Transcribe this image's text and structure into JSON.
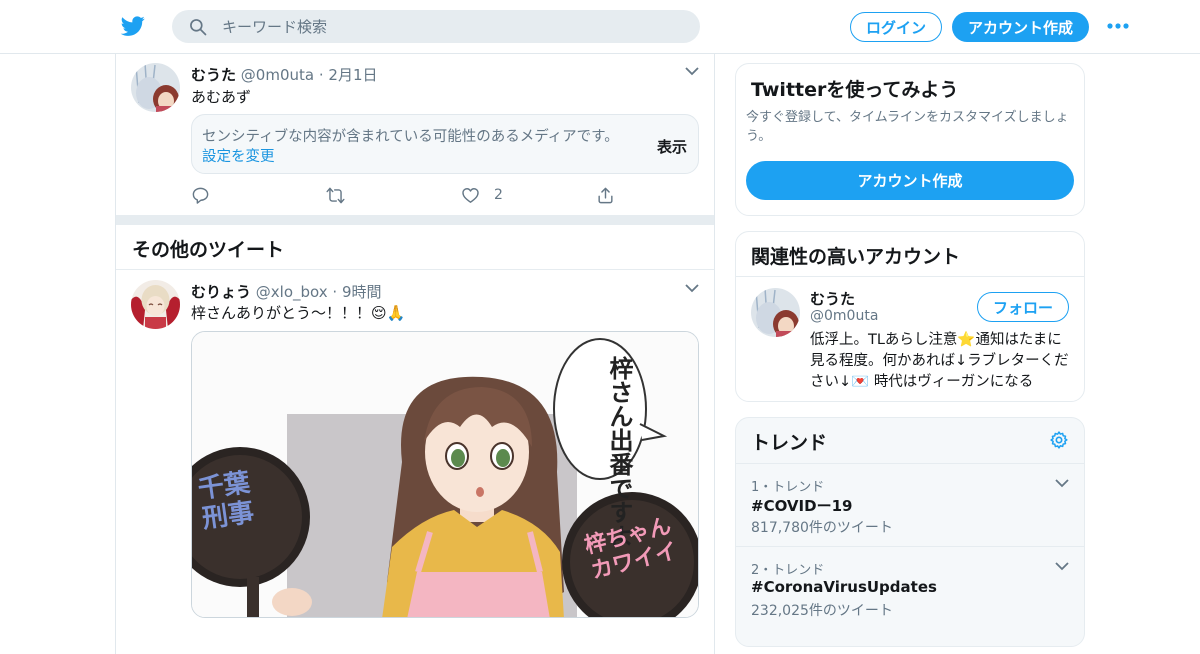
{
  "header": {
    "search_placeholder": "キーワード検索",
    "login_label": "ログイン",
    "signup_label": "アカウント作成"
  },
  "tweet1": {
    "name": "むうた",
    "handle": "@0m0uta",
    "date": "2月1日",
    "text": "あむあず",
    "sensitive_message": "センシティブな内容が含まれている可能性のあるメディアです。",
    "change_settings": "設定を変更",
    "show_label": "表示",
    "like_count": "2"
  },
  "more_tweets_title": "その他のツイート",
  "tweet2": {
    "name": "むりょう",
    "handle": "@xlo_box",
    "time": "9時間",
    "text": "梓さんありがとう～！！！😌🙏",
    "media_bubble_text": "梓さん出番ですよ",
    "media_sign_left": "千葉刑事",
    "media_sign_right": "梓ちゃんカワイイ"
  },
  "sidebar": {
    "try_title": "Twitterを使ってみよう",
    "try_desc": "今すぐ登録して、タイムラインをカスタマイズしましょう。",
    "try_cta": "アカウント作成",
    "related_title": "関連性の高いアカウント",
    "related_account": {
      "name": "むうた",
      "handle": "@0m0uta",
      "follow_label": "フォロー",
      "bio": "低浮上。TLあらし注意⭐通知はたまに見る程度。何かあれば↓ラブレターください↓💌 時代はヴィーガンになる"
    },
    "trends_title": "トレンド",
    "trends": [
      {
        "rank": "1・トレンド",
        "tag": "#COVIDー19",
        "count": "817,780件のツイート"
      },
      {
        "rank": "2・トレンド",
        "tag": "#CoronaVirusUpdates",
        "count": "232,025件のツイート"
      }
    ]
  },
  "colors": {
    "brand": "#1da1f2",
    "secondary_text": "#657786",
    "border": "#e6ecf0",
    "pink_apron": "#f4b6c2",
    "yellow_top": "#e8b84a"
  }
}
